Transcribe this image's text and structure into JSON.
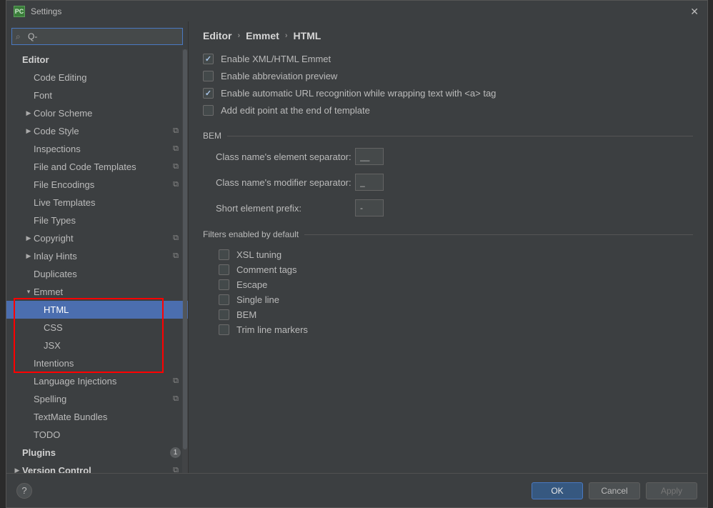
{
  "window": {
    "title": "Settings",
    "app_icon_text": "PC"
  },
  "search": {
    "prefix": "Q-",
    "placeholder": ""
  },
  "tree": {
    "editor": "Editor",
    "code_editing": "Code Editing",
    "font": "Font",
    "color_scheme": "Color Scheme",
    "code_style": "Code Style",
    "inspections": "Inspections",
    "file_code_templates": "File and Code Templates",
    "file_encodings": "File Encodings",
    "live_templates": "Live Templates",
    "file_types": "File Types",
    "copyright": "Copyright",
    "inlay_hints": "Inlay Hints",
    "duplicates": "Duplicates",
    "emmet": "Emmet",
    "emmet_html": "HTML",
    "emmet_css": "CSS",
    "emmet_jsx": "JSX",
    "intentions": "Intentions",
    "language_injections": "Language Injections",
    "spelling": "Spelling",
    "textmate_bundles": "TextMate Bundles",
    "todo": "TODO",
    "plugins": "Plugins",
    "plugins_count": "1",
    "version_control": "Version Control"
  },
  "breadcrumb": {
    "editor": "Editor",
    "emmet": "Emmet",
    "html": "HTML"
  },
  "options": {
    "enable_xml_html_emmet": "Enable XML/HTML Emmet",
    "enable_abbrev_preview": "Enable abbreviation preview",
    "enable_auto_url": "Enable automatic URL recognition while wrapping text with <a> tag",
    "add_edit_point": "Add edit point at the end of template"
  },
  "bem": {
    "title": "BEM",
    "element_sep_label": "Class name's element separator:",
    "element_sep_value": "__",
    "modifier_sep_label": "Class name's modifier separator:",
    "modifier_sep_value": "_",
    "short_prefix_label": "Short element prefix:",
    "short_prefix_value": "-"
  },
  "filters": {
    "title": "Filters enabled by default",
    "xsl": "XSL tuning",
    "comment": "Comment tags",
    "escape": "Escape",
    "single_line": "Single line",
    "bem": "BEM",
    "trim": "Trim line markers"
  },
  "footer": {
    "help": "?",
    "ok": "OK",
    "cancel": "Cancel",
    "apply": "Apply"
  }
}
